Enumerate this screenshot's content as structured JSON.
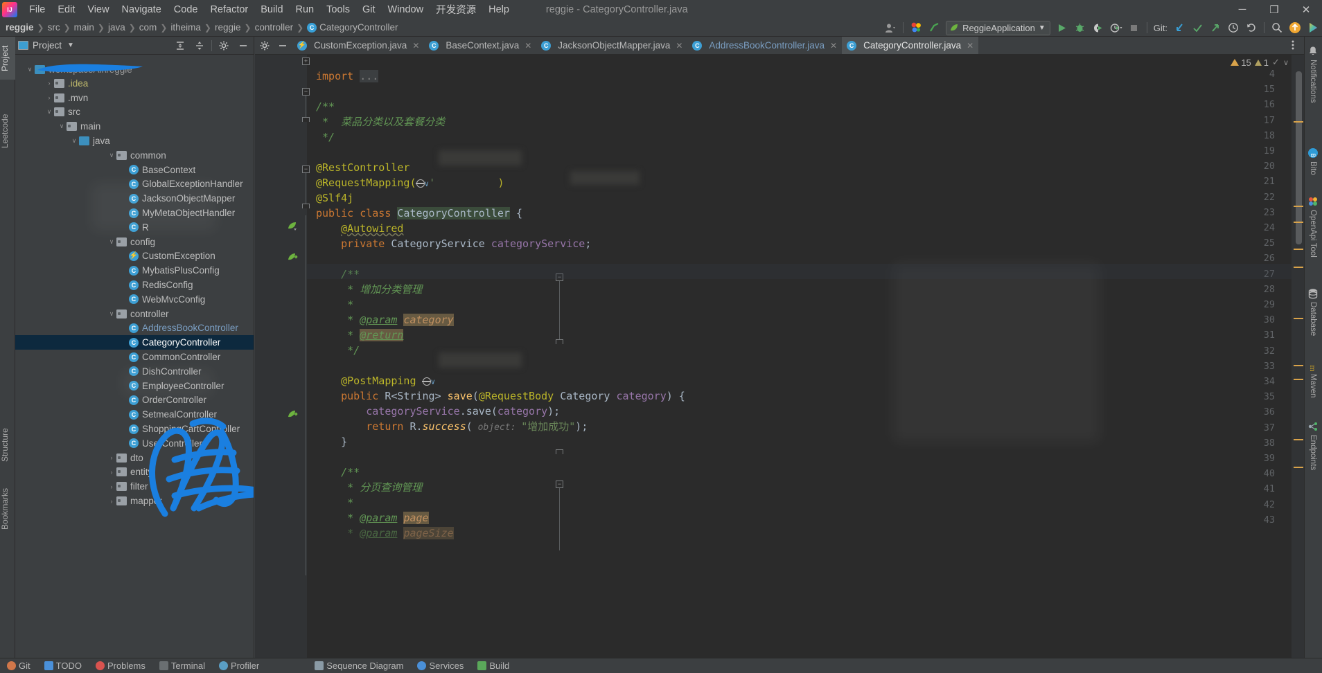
{
  "window": {
    "title": "reggie - CategoryController.java",
    "controls": {
      "minimize": "─",
      "maximize": "❐",
      "close": "✕"
    }
  },
  "menubar": {
    "logo_icon": "intellij-idea-logo",
    "items": [
      "File",
      "Edit",
      "View",
      "Navigate",
      "Code",
      "Refactor",
      "Build",
      "Run",
      "Tools",
      "Git",
      "Window",
      "开发资源",
      "Help"
    ]
  },
  "navbar": {
    "breadcrumbs": [
      "reggie",
      "src",
      "main",
      "java",
      "com",
      "itheima",
      "reggie",
      "controller",
      "CategoryController"
    ],
    "run_configuration": "ReggieApplication",
    "git_label": "Git:",
    "icons": {
      "account": "user-account-icon",
      "updates": "google-colored-icon",
      "checkmark": "green-check-icon",
      "run": "run-icon",
      "debug": "debug-icon",
      "run_coverage": "run-with-coverage-icon",
      "profiler": "profiler-icon",
      "stop": "stop-icon",
      "git_update": "git-update-project-icon",
      "git_commit": "git-commit-icon",
      "git_push": "git-push-icon",
      "git_history": "git-history-icon",
      "git_rollback": "git-rollback-icon",
      "search_everywhere": "search-icon",
      "upload": "upload-icon",
      "rainbow": "ide-feature-icon"
    }
  },
  "left_strip": {
    "tabs": [
      "Project",
      "Leetcode"
    ],
    "bottom_tabs": [
      "Structure",
      "Bookmarks"
    ]
  },
  "right_strip": {
    "tabs": [
      {
        "label": "Notifications",
        "icon": "bell-icon"
      },
      {
        "label": "Bito",
        "icon": "bito-icon"
      },
      {
        "label": "OpenApi Tool",
        "icon": "openapi-icon"
      },
      {
        "label": "Database",
        "icon": "database-icon"
      },
      {
        "label": "Maven",
        "icon": "maven-m-icon"
      },
      {
        "label": "Endpoints",
        "icon": "endpoints-icon"
      }
    ]
  },
  "project_panel": {
    "title": "Project",
    "icons": {
      "view_selector": "chevron-down-icon",
      "expand_all": "expand-all-icon",
      "collapse_all": "collapse-all-icon",
      "settings": "gear-icon",
      "hide": "hide-icon"
    },
    "root_label": "workspaceAll\\reggie",
    "root_redacted_prefix": "▬▬▬▬▬",
    "tree": [
      {
        "label": ".idea",
        "depth": 2,
        "arrow": "›",
        "icon": "folder",
        "style": "yellowish"
      },
      {
        "label": ".mvn",
        "depth": 2,
        "arrow": "›",
        "icon": "folder",
        "style": "normal"
      },
      {
        "label": "src",
        "depth": 2,
        "arrow": "∨",
        "icon": "folder",
        "style": "normal"
      },
      {
        "label": "main",
        "depth": 3,
        "arrow": "∨",
        "icon": "folder",
        "style": "normal"
      },
      {
        "label": "java",
        "depth": 4,
        "arrow": "∨",
        "icon": "folder-src",
        "style": "normal"
      },
      {
        "label": "common",
        "depth": 7,
        "arrow": "∨",
        "icon": "folder",
        "style": "normal"
      },
      {
        "label": "BaseContext",
        "depth": 8,
        "arrow": "",
        "icon": "class",
        "style": "normal"
      },
      {
        "label": "GlobalExceptionHandler",
        "depth": 8,
        "arrow": "",
        "icon": "class",
        "style": "normal"
      },
      {
        "label": "JacksonObjectMapper",
        "depth": 8,
        "arrow": "",
        "icon": "class",
        "style": "normal"
      },
      {
        "label": "MyMetaObjectHandler",
        "depth": 8,
        "arrow": "",
        "icon": "class",
        "style": "normal"
      },
      {
        "label": "R",
        "depth": 8,
        "arrow": "",
        "icon": "class",
        "style": "normal"
      },
      {
        "label": "config",
        "depth": 7,
        "arrow": "∨",
        "icon": "folder",
        "style": "normal"
      },
      {
        "label": "CustomException",
        "depth": 8,
        "arrow": "",
        "icon": "exception",
        "style": "normal"
      },
      {
        "label": "MybatisPlusConfig",
        "depth": 8,
        "arrow": "",
        "icon": "class",
        "style": "normal"
      },
      {
        "label": "RedisConfig",
        "depth": 8,
        "arrow": "",
        "icon": "class",
        "style": "normal"
      },
      {
        "label": "WebMvcConfig",
        "depth": 8,
        "arrow": "",
        "icon": "class",
        "style": "normal"
      },
      {
        "label": "controller",
        "depth": 7,
        "arrow": "∨",
        "icon": "folder",
        "style": "normal"
      },
      {
        "label": "AddressBookController",
        "depth": 8,
        "arrow": "",
        "icon": "class",
        "style": "lib"
      },
      {
        "label": "CategoryController",
        "depth": 8,
        "arrow": "",
        "icon": "class",
        "style": "normal",
        "selected": true
      },
      {
        "label": "CommonController",
        "depth": 8,
        "arrow": "",
        "icon": "class",
        "style": "normal"
      },
      {
        "label": "DishController",
        "depth": 8,
        "arrow": "",
        "icon": "class",
        "style": "normal"
      },
      {
        "label": "EmployeeController",
        "depth": 8,
        "arrow": "",
        "icon": "class",
        "style": "normal"
      },
      {
        "label": "OrderController",
        "depth": 8,
        "arrow": "",
        "icon": "class",
        "style": "normal"
      },
      {
        "label": "SetmealController",
        "depth": 8,
        "arrow": "",
        "icon": "class",
        "style": "normal"
      },
      {
        "label": "ShoppingCartController",
        "depth": 8,
        "arrow": "",
        "icon": "class",
        "style": "normal"
      },
      {
        "label": "UserController",
        "depth": 8,
        "arrow": "",
        "icon": "class",
        "style": "normal"
      },
      {
        "label": "dto",
        "depth": 7,
        "arrow": "›",
        "icon": "folder",
        "style": "normal"
      },
      {
        "label": "entity",
        "depth": 7,
        "arrow": "›",
        "icon": "folder",
        "style": "normal"
      },
      {
        "label": "filter",
        "depth": 7,
        "arrow": "›",
        "icon": "folder",
        "style": "normal"
      },
      {
        "label": "mapper",
        "depth": 7,
        "arrow": "›",
        "icon": "folder",
        "style": "normal"
      }
    ]
  },
  "editor": {
    "tabs": [
      {
        "label": "CustomException.java",
        "icon": "exception",
        "active": false,
        "closeable": true
      },
      {
        "label": "BaseContext.java",
        "icon": "class",
        "active": false,
        "closeable": true
      },
      {
        "label": "JacksonObjectMapper.java",
        "icon": "class",
        "active": false,
        "closeable": true
      },
      {
        "label": "AddressBookController.java",
        "icon": "class",
        "active": false,
        "closeable": true,
        "modified": true
      },
      {
        "label": "CategoryController.java",
        "icon": "class",
        "active": true,
        "closeable": true
      }
    ],
    "toolbar_icons": {
      "settings": "gear-icon",
      "hide": "minimize-icon",
      "more": "more-options-icon"
    },
    "inspections": {
      "warnings": "15",
      "weak_warnings": "1",
      "checkmark": "✓",
      "chevron": "∨"
    },
    "line_numbers": [
      "4",
      "15",
      "16",
      "17",
      "18",
      "19",
      "20",
      "21",
      "22",
      "23",
      "24",
      "25",
      "26",
      "27",
      "28",
      "29",
      "30",
      "31",
      "32",
      "33",
      "34",
      "35",
      "36",
      "37",
      "38",
      "39",
      "40",
      "41",
      "42",
      "43"
    ],
    "code_lines": [
      {
        "n": "4",
        "text": "import ..."
      },
      {
        "n": "15",
        "text": ""
      },
      {
        "n": "16",
        "text": "/**"
      },
      {
        "n": "17",
        "text": " *  菜品分类以及套餐分类"
      },
      {
        "n": "18",
        "text": " */"
      },
      {
        "n": "19",
        "text": ""
      },
      {
        "n": "20",
        "text": "@RestController"
      },
      {
        "n": "21",
        "text": "@RequestMapping(    )"
      },
      {
        "n": "22",
        "text": "@Slf4j"
      },
      {
        "n": "23",
        "text": "public class CategoryController {"
      },
      {
        "n": "24",
        "text": "    @Autowired"
      },
      {
        "n": "25",
        "text": "    private CategoryService categoryService;"
      },
      {
        "n": "26",
        "text": ""
      },
      {
        "n": "27",
        "text": "    /**"
      },
      {
        "n": "28",
        "text": "     * 增加分类管理"
      },
      {
        "n": "29",
        "text": "     *"
      },
      {
        "n": "30",
        "text": "     * @param category"
      },
      {
        "n": "31",
        "text": "     * @return"
      },
      {
        "n": "32",
        "text": "     */"
      },
      {
        "n": "33",
        "text": "    @PostMapping"
      },
      {
        "n": "34",
        "text": "    public R<String> save(@RequestBody Category category) {"
      },
      {
        "n": "35",
        "text": "        categoryService.save(category);"
      },
      {
        "n": "36",
        "text": "        return R.success( object: \"增加成功\");"
      },
      {
        "n": "37",
        "text": "    }"
      },
      {
        "n": "38",
        "text": ""
      },
      {
        "n": "39",
        "text": "    /**"
      },
      {
        "n": "40",
        "text": "     * 分页查询管理"
      },
      {
        "n": "41",
        "text": "     *"
      },
      {
        "n": "42",
        "text": "     * @param page"
      },
      {
        "n": "43",
        "text": "     * @param pageSize"
      }
    ],
    "param_hint_save": "object:",
    "string_literal": "\"增加成功\""
  },
  "status_bar": {
    "items": [
      "Git",
      "TODO",
      "Problems",
      "Terminal",
      "Profiler",
      "Services",
      "Sequence Diagram",
      "Build"
    ]
  },
  "colors": {
    "accent_blue": "#3d9fd4",
    "selection": "#0d293e",
    "editor_bg": "#2b2b2b",
    "panel_bg": "#3c3f41",
    "scribble": "#1a7fe0",
    "keyword": "#cc7832",
    "annotation": "#bbb529",
    "comment": "#629755",
    "string": "#6a8759",
    "field": "#9876aa"
  }
}
